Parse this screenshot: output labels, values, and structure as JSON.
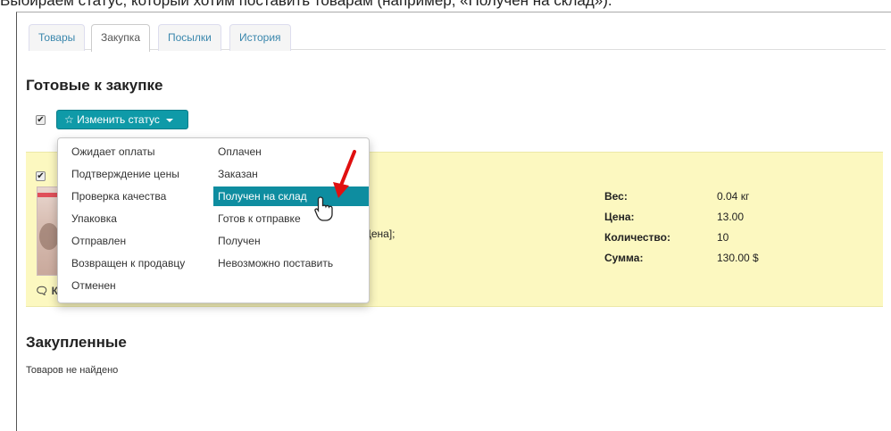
{
  "caption": "Выбираем статус, который хотим поставить товарам (например, «Получен на склад»).",
  "tabs": [
    {
      "label": "Товары"
    },
    {
      "label": "Закупка"
    },
    {
      "label": "Посылки"
    },
    {
      "label": "История"
    }
  ],
  "ready": {
    "title": "Готовые к закупке",
    "status_button": "Изменить статус",
    "status_icon": "star-outline-icon"
  },
  "menu": {
    "left_col": [
      "Ожидает оплаты",
      "Подтверждение цены",
      "Проверка качества",
      "Упаковка",
      "Отправлен",
      "Возвращен к продавцу",
      "Отменен"
    ],
    "right_col": [
      "Оплачен",
      "Заказан",
      "Получен на склад",
      "Готов к отправке",
      "Получен",
      "Невозможно поставить"
    ],
    "selected": "Получен на склад"
  },
  "item": {
    "formula_fragment": "Цена];",
    "comment_fragment": "К",
    "weight_label": "Вес:",
    "weight_value": "0.04 кг",
    "price_label": "Цена:",
    "price_value": "13.00",
    "qty_label": "Количество:",
    "qty_value": "10",
    "sum_label": "Сумма:",
    "sum_value": "130.00 $"
  },
  "purchased": {
    "title": "Закупленные",
    "empty_text": "Товаров не найдено"
  },
  "colors": {
    "accent": "#0f9aa8",
    "selected_item": "#0e8da0",
    "highlight_row": "#fcf8c0",
    "arrow": "#e01010"
  }
}
